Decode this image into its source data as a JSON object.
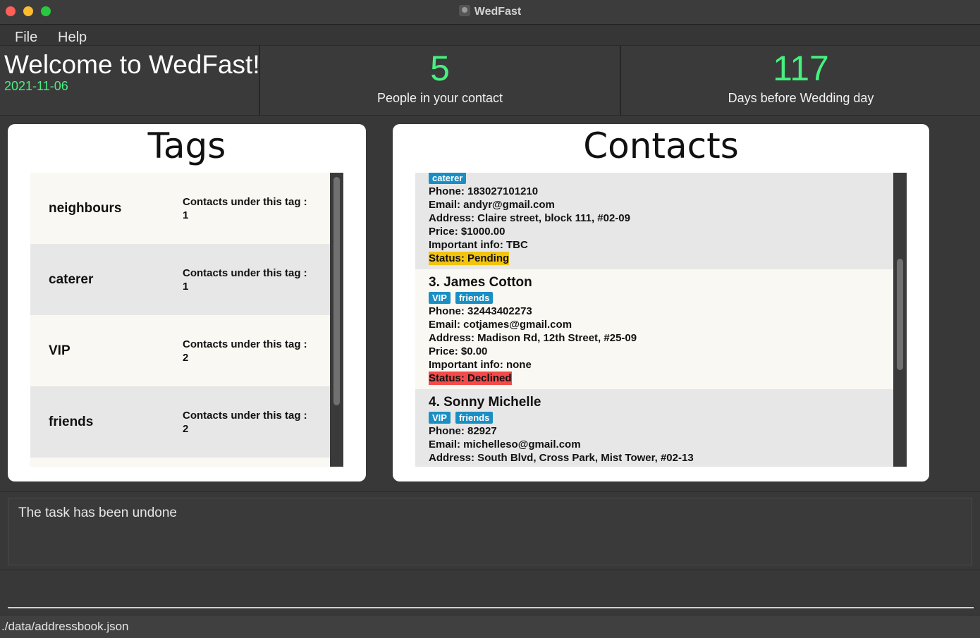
{
  "window": {
    "title": "WedFast"
  },
  "menu": {
    "file": "File",
    "help": "Help"
  },
  "header": {
    "welcome": "Welcome to WedFast!",
    "date": "2021-11-06",
    "contacts_count": "5",
    "contacts_label": "People in your contact",
    "days_count": "117",
    "days_label": "Days before Wedding day"
  },
  "tags_panel": {
    "title": "Tags",
    "count_label": "Contacts under this tag :",
    "items": [
      {
        "name": "neighbours",
        "count": "1"
      },
      {
        "name": "caterer",
        "count": "1"
      },
      {
        "name": "VIP",
        "count": "2"
      },
      {
        "name": "friends",
        "count": "2"
      }
    ]
  },
  "contacts_panel": {
    "title": "Contacts",
    "contacts": [
      {
        "tags": [
          "caterer"
        ],
        "phone": "Phone: 183027101210",
        "email": "Email: andyr@gmail.com",
        "address": "Address: Claire street, block 111, #02-09",
        "price": "Price: $1000.00",
        "info": "Important info: TBC",
        "status": "Status: Pending"
      },
      {
        "index_name": "3.  James Cotton",
        "tags": [
          "VIP",
          "friends"
        ],
        "phone": "Phone: 32443402273",
        "email": "Email: cotjames@gmail.com",
        "address": "Address: Madison Rd, 12th Street, #25-09",
        "price": "Price: $0.00",
        "info": "Important info: none",
        "status": "Status: Declined"
      },
      {
        "index_name": "4.  Sonny Michelle",
        "tags": [
          "VIP",
          "friends"
        ],
        "phone": "Phone: 82927",
        "email": "Email: michelleso@gmail.com",
        "address": "Address: South Blvd, Cross Park, Mist Tower, #02-13"
      }
    ]
  },
  "result": {
    "text": "The task has been undone"
  },
  "command": {
    "value": "",
    "placeholder": ""
  },
  "statusbar": {
    "path": "./data/addressbook.json"
  },
  "colors": {
    "accent_green": "#46f07f",
    "tag_blue": "#1a8fc4",
    "pending": "#f2c40f",
    "declined": "#f34a4a"
  }
}
